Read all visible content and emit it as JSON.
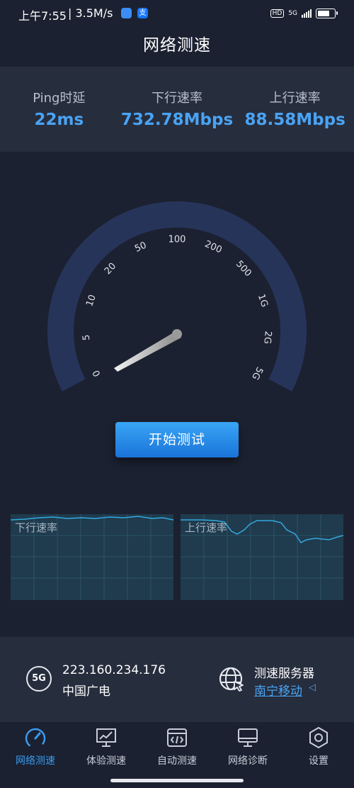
{
  "status_bar": {
    "time": "上午7:55",
    "speed": "| 3.5M/s",
    "network": "5G",
    "hd": "HD",
    "alipay": "支"
  },
  "header": {
    "title": "网络测速"
  },
  "stats": [
    {
      "label": "Ping时延",
      "value": "22ms"
    },
    {
      "label": "下行速率",
      "value": "732.78Mbps"
    },
    {
      "label": "上行速率",
      "value": "88.58Mbps"
    }
  ],
  "gauge": {
    "ticks": [
      "0",
      "5",
      "10",
      "20",
      "50",
      "100",
      "200",
      "500",
      "1G",
      "2G",
      "5G"
    ]
  },
  "start_button": {
    "label": "开始测试"
  },
  "graphs": {
    "download_title": "下行速率",
    "upload_title": "上行速率"
  },
  "server": {
    "badge": "5G",
    "ip": "223.160.234.176",
    "isp": "中国广电",
    "label": "测速服务器",
    "name": "南宁移动",
    "arrow": "◁"
  },
  "nav": [
    {
      "label": "网络测速",
      "icon": "speedometer-icon",
      "active": true
    },
    {
      "label": "体验测速",
      "icon": "chart-monitor-icon",
      "active": false
    },
    {
      "label": "自动测速",
      "icon": "code-window-icon",
      "active": false
    },
    {
      "label": "网络诊断",
      "icon": "monitor-icon",
      "active": false
    },
    {
      "label": "设置",
      "icon": "settings-hexagon-icon",
      "active": false
    }
  ],
  "colors": {
    "accent": "#3a9bf0",
    "background": "#1b2130",
    "panel": "#262d3d",
    "gauge_track": "#27345a"
  }
}
